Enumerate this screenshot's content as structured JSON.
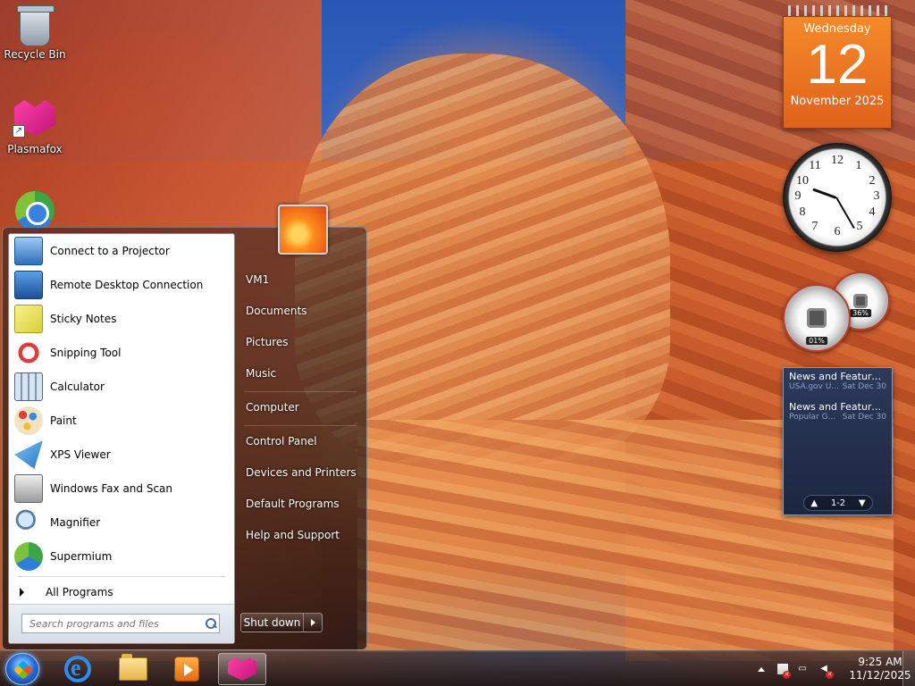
{
  "desktop": {
    "icons": [
      {
        "label": "Recycle Bin",
        "icon": "recycle-bin-icon"
      },
      {
        "label": "Plasmafox",
        "icon": "plasmafox-icon"
      },
      {
        "label": "",
        "icon": "supermium-icon"
      }
    ]
  },
  "gadgets": {
    "calendar": {
      "weekday": "Wednesday",
      "day": "12",
      "month_year": "November 2025"
    },
    "clock": {
      "numbers": [
        "12",
        "1",
        "2",
        "3",
        "4",
        "5",
        "6",
        "7",
        "8",
        "9",
        "10",
        "11"
      ],
      "time": "9:25"
    },
    "meters": {
      "cpu": "01%",
      "memory": "36%"
    },
    "news": {
      "items": [
        {
          "title": "News and Feature...",
          "source": "USA.gov U...",
          "date": "Sat Dec 30"
        },
        {
          "title": "News and Feature...",
          "source": "Popular G...",
          "date": "Sat Dec 30"
        }
      ],
      "pager": "1-2"
    }
  },
  "start_menu": {
    "programs": [
      {
        "label": "Connect to a Projector",
        "icon": "projector-icon"
      },
      {
        "label": "Remote Desktop Connection",
        "icon": "remote-desktop-icon"
      },
      {
        "label": "Sticky Notes",
        "icon": "sticky-notes-icon"
      },
      {
        "label": "Snipping Tool",
        "icon": "snipping-tool-icon"
      },
      {
        "label": "Calculator",
        "icon": "calculator-icon"
      },
      {
        "label": "Paint",
        "icon": "paint-icon"
      },
      {
        "label": "XPS Viewer",
        "icon": "xps-viewer-icon"
      },
      {
        "label": "Windows Fax and Scan",
        "icon": "fax-scan-icon"
      },
      {
        "label": "Magnifier",
        "icon": "magnifier-icon"
      },
      {
        "label": "Supermium",
        "icon": "supermium-icon"
      }
    ],
    "all_programs": "All Programs",
    "search_placeholder": "Search programs and files",
    "right": {
      "user": "VM1",
      "documents": "Documents",
      "pictures": "Pictures",
      "music": "Music",
      "computer": "Computer",
      "control_panel": "Control Panel",
      "devices_printers": "Devices and Printers",
      "default_programs": "Default Programs",
      "help_support": "Help and Support"
    },
    "shutdown": "Shut down"
  },
  "taskbar": {
    "pinned": [
      "internet-explorer-icon",
      "file-explorer-icon",
      "media-player-icon",
      "plasmafox-icon"
    ],
    "time": "9:25 AM",
    "date": "11/12/2025"
  },
  "colors": {
    "calendar": "#e86a1e",
    "start_orb": "#2a6ad0",
    "plasmafox": "#e0268c"
  }
}
